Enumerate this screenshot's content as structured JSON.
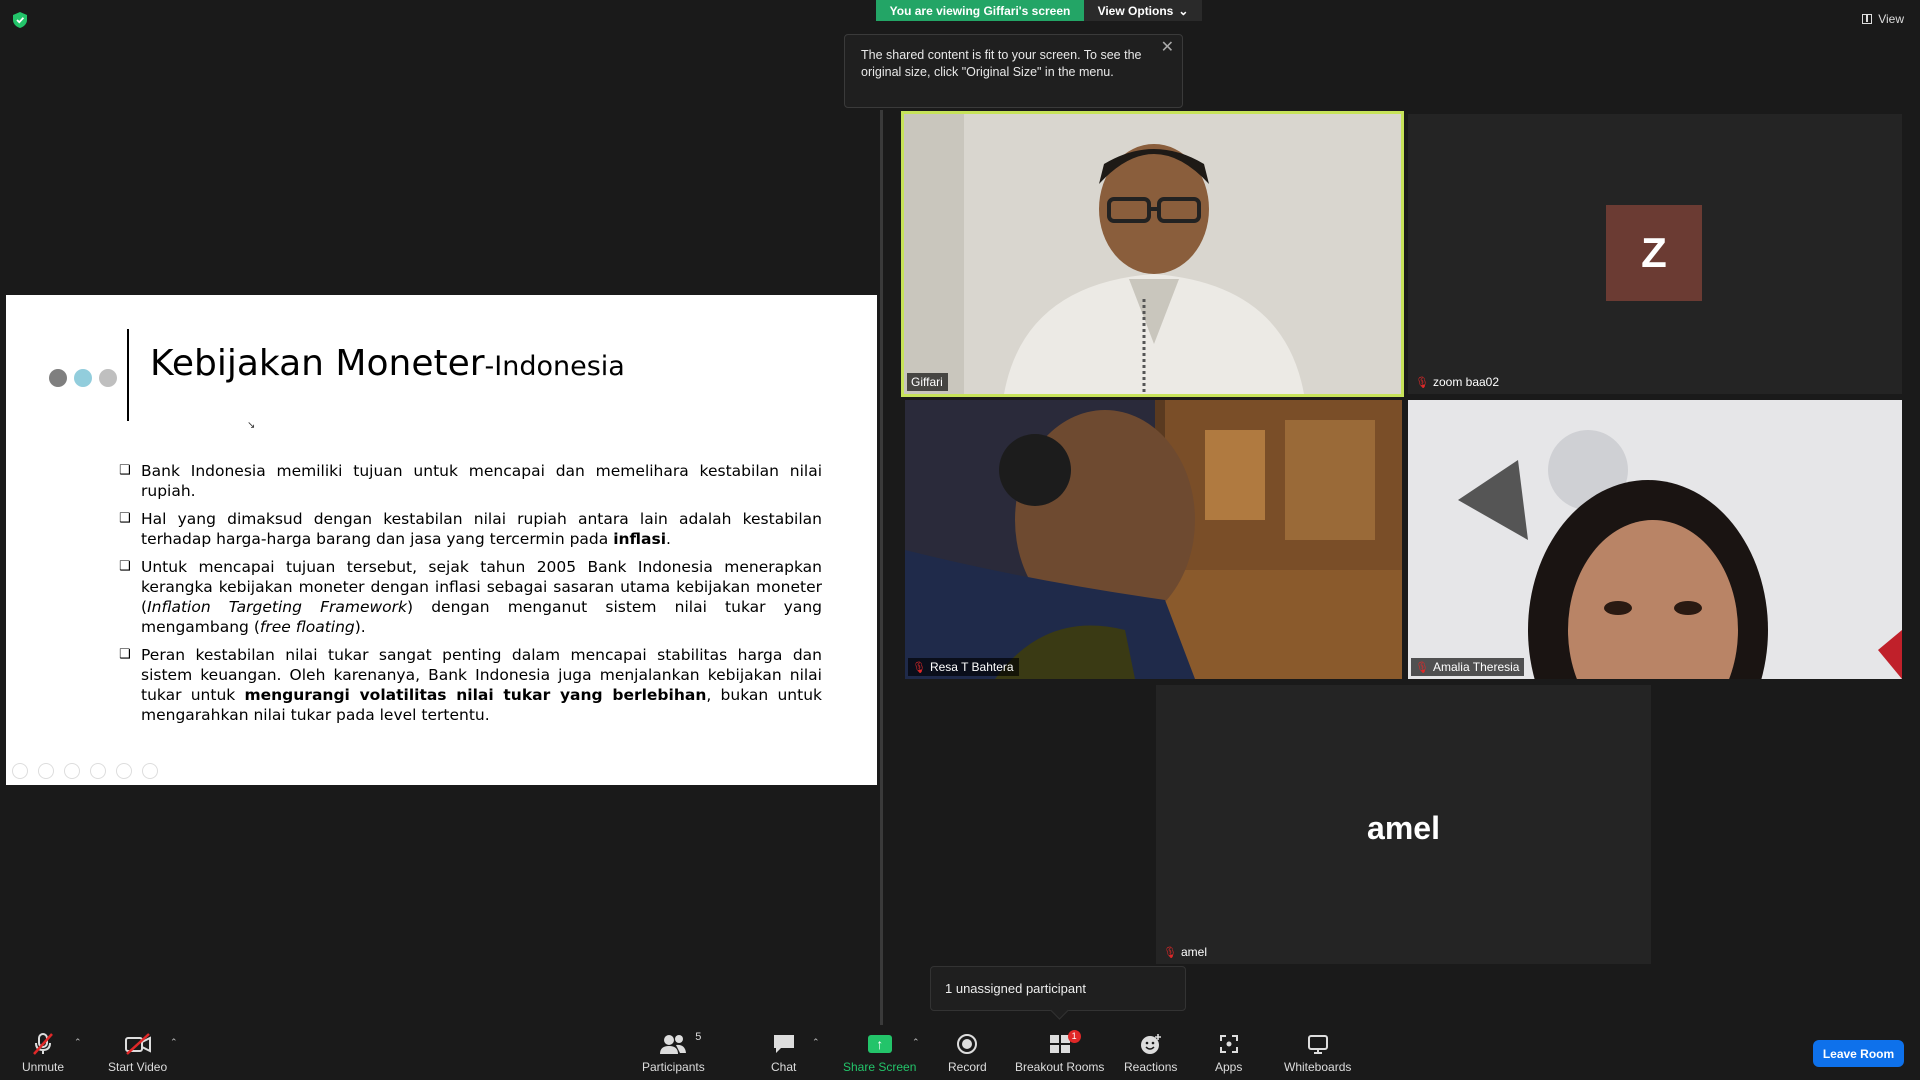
{
  "header": {
    "viewing_banner": "You are viewing Giffari's screen",
    "view_options": "View Options",
    "view_label": "View"
  },
  "tooltip": {
    "text": "The shared content is fit to your screen. To see the original size, click \"Original Size\" in the menu."
  },
  "slide": {
    "title": "Kebijakan Moneter",
    "title_suffix": "-Indonesia",
    "dot_colors": [
      "#7f7f7f",
      "#92cddc",
      "#bfbfbf"
    ],
    "bullets": [
      {
        "parts": [
          {
            "t": "Bank Indonesia memiliki tujuan untuk mencapai dan memelihara kestabilan nilai rupiah."
          }
        ]
      },
      {
        "parts": [
          {
            "t": "Hal yang dimaksud dengan kestabilan nilai rupiah antara lain adalah kestabilan terhadap harga-harga  barang dan jasa yang tercermin pada "
          },
          {
            "t": "inflasi",
            "b": true
          },
          {
            "t": "."
          }
        ]
      },
      {
        "parts": [
          {
            "t": "Untuk mencapai tujuan tersebut, sejak tahun 2005 Bank Indonesia menerapkan kerangka kebijakan  moneter dengan inflasi sebagai sasaran utama kebijakan moneter ("
          },
          {
            "t": "Inflation Targeting Framework",
            "i": true
          },
          {
            "t": ")  dengan menganut sistem nilai tukar yang mengambang ("
          },
          {
            "t": "free floating",
            "i": true
          },
          {
            "t": ")."
          }
        ]
      },
      {
        "parts": [
          {
            "t": "Peran kestabilan nilai tukar sangat penting dalam mencapai stabilitas harga dan sistem keuangan.  Oleh karenanya, Bank Indonesia juga menjalankan kebijakan nilai tukar untuk "
          },
          {
            "t": "mengurangi volatilitas  nilai tukar yang berlebihan",
            "b": true
          },
          {
            "t": ", bukan untuk mengarahkan nilai tukar pada level tertentu."
          }
        ]
      }
    ]
  },
  "participants": {
    "giffari": {
      "name": "Giffari"
    },
    "zoom": {
      "name": "zoom baa02",
      "initial": "Z"
    },
    "resa": {
      "name": "Resa T Bahtera"
    },
    "amalia": {
      "name": "Amalia Theresia"
    },
    "amel": {
      "name": "amel",
      "display": "amel"
    }
  },
  "breakout_note": "1 unassigned participant",
  "toolbar": {
    "unmute": "Unmute",
    "start_video": "Start Video",
    "participants": "Participants",
    "participants_count": "5",
    "chat": "Chat",
    "share_screen": "Share Screen",
    "record": "Record",
    "breakout_rooms": "Breakout Rooms",
    "breakout_badge": "1",
    "reactions": "Reactions",
    "apps": "Apps",
    "whiteboards": "Whiteboards",
    "leave_room": "Leave Room"
  },
  "colors": {
    "share_green": "#23a566",
    "active_speaker": "#c7e35a",
    "leave_blue": "#0e71eb",
    "muted_red": "#e02828",
    "avatar_z": "#6b3b33"
  }
}
